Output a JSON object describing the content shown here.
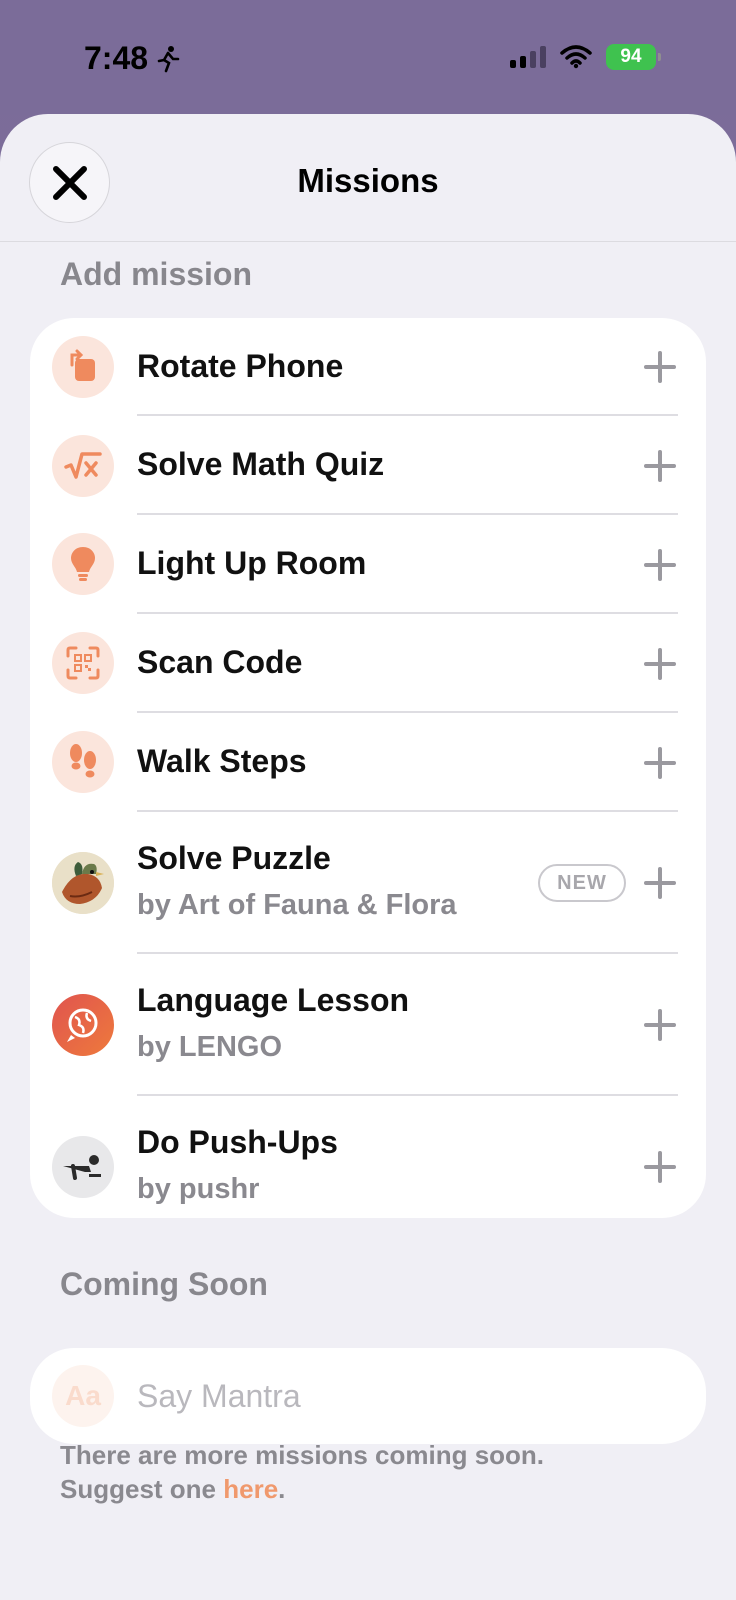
{
  "status": {
    "time": "7:48",
    "battery": "94"
  },
  "header": {
    "title": "Missions"
  },
  "add_section": {
    "title": "Add mission",
    "items": [
      {
        "title": "Rotate Phone",
        "icon": "rotate-phone-icon"
      },
      {
        "title": "Solve Math Quiz",
        "icon": "square-root-icon"
      },
      {
        "title": "Light Up Room",
        "icon": "lightbulb-icon"
      },
      {
        "title": "Scan Code",
        "icon": "qr-scan-icon"
      },
      {
        "title": "Walk Steps",
        "icon": "footprints-icon"
      },
      {
        "title": "Solve Puzzle",
        "subtitle": "by Art of Fauna & Flora",
        "badge": "NEW",
        "icon": "bird-artwork-icon"
      },
      {
        "title": "Language Lesson",
        "subtitle": "by LENGO",
        "icon": "lengo-globe-icon"
      },
      {
        "title": "Do Push-Ups",
        "subtitle": "by pushr",
        "icon": "pushup-icon"
      }
    ]
  },
  "coming_soon": {
    "title": "Coming Soon",
    "items": [
      {
        "title": "Say Mantra",
        "icon_text": "Aa"
      }
    ]
  },
  "footer": {
    "line1": "There are more missions coming soon.",
    "line2_prefix": "Suggest one ",
    "link": "here",
    "line2_suffix": "."
  },
  "colors": {
    "accent": "#f0996d",
    "icon_bg": "#fbe5dc",
    "backdrop": "#7b6c99"
  }
}
